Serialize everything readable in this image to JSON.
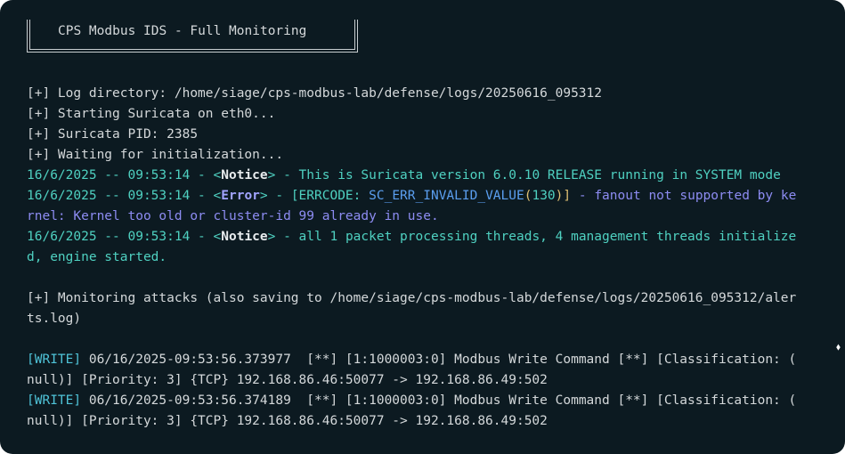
{
  "banner": {
    "title": "CPS Modbus IDS - Full Monitoring"
  },
  "lines": {
    "l1": "[+] Log directory: /home/siage/cps-modbus-lab/defense/logs/20250616_095312",
    "l2": "[+] Starting Suricata on eth0...",
    "l3": "[+] Suricata PID: 2385",
    "l4": "[+] Waiting for initialization...",
    "n1_ts": "16/6/2025 -- 09:53:14 - <",
    "n1_tag": "Notice",
    "n1_rest": "> - This is Suricata version 6.0.10 RELEASE running in SYSTEM mode",
    "e_ts": "16/6/2025 -- 09:53:14 - <",
    "e_tag": "Error",
    "e_mid": "> - [ERRCODE: ",
    "e_code": "SC_ERR_INVALID_VALUE",
    "e_p1": "(",
    "e_num": "130",
    "e_p2": ")]",
    "e_rest": " - fanout not supported by ke",
    "e_wrap": "rnel: Kernel too old or cluster-id 99 already in use.",
    "n2_ts": "16/6/2025 -- 09:53:14 - <",
    "n2_tag": "Notice",
    "n2_rest": "> - all 1 packet processing threads, 4 management threads initialize",
    "n2_wrap": "d, engine started.",
    "m1": "[+] Monitoring attacks (also saving to /home/siage/cps-modbus-lab/defense/logs/20250616_095312/aler",
    "m2": "ts.log)",
    "w1_tag": "[WRITE]",
    "w1_rest": " 06/16/2025-09:53:56.373977  [**] [1:1000003:0] Modbus Write Command [**] [Classification: (",
    "w1_wrap": "null)] [Priority: 3] {TCP} 192.168.86.46:50077 -> 192.168.86.49:502",
    "w2_tag": "[WRITE]",
    "w2_rest": " 06/16/2025-09:53:56.374189  [**] [1:1000003:0] Modbus Write Command [**] [Classification: (",
    "w2_wrap": "null)] [Priority: 3] {TCP} 192.168.86.46:50077 -> 192.168.86.49:502"
  },
  "scroll_indicator": "⬧"
}
